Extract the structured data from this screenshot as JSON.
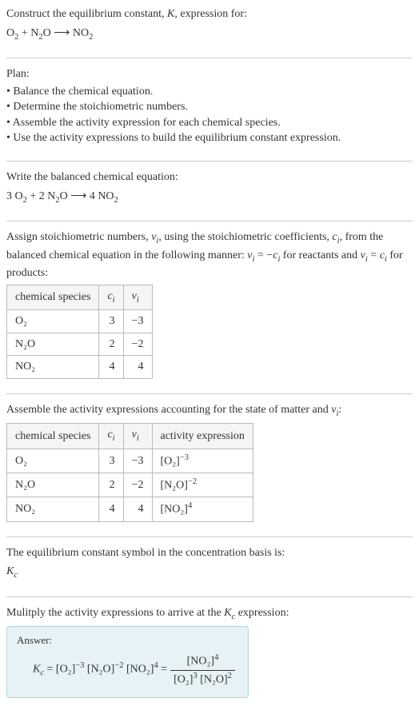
{
  "header": {
    "line1": "Construct the equilibrium constant, ",
    "kvar": "K",
    "line1b": ", expression for:",
    "equation_lhs": "O",
    "equation_plus": " + N",
    "equation_arrow": " ⟶ NO"
  },
  "plan": {
    "title": "Plan:",
    "items": [
      "• Balance the chemical equation.",
      "• Determine the stoichiometric numbers.",
      "• Assemble the activity expression for each chemical species.",
      "• Use the activity expressions to build the equilibrium constant expression."
    ]
  },
  "balanced": {
    "intro": "Write the balanced chemical equation:",
    "c1": "3 O",
    "c2": " + 2 N",
    "c3": "O ⟶ 4 NO"
  },
  "assign": {
    "intro1": "Assign stoichiometric numbers, ",
    "nu": "ν",
    "sub_i": "i",
    "intro2": ", using the stoichiometric coefficients, ",
    "cvar": "c",
    "intro3": ", from the balanced chemical equation in the following manner: ",
    "rel1": " = −",
    "rel2": " for reactants and ",
    "rel3": " = ",
    "rel4": " for products:",
    "headers": [
      "chemical species",
      "c",
      "ν"
    ],
    "rows": [
      {
        "species": "O₂",
        "c": "3",
        "nu": "−3"
      },
      {
        "species": "N₂O",
        "c": "2",
        "nu": "−2"
      },
      {
        "species": "NO₂",
        "c": "4",
        "nu": "4"
      }
    ]
  },
  "activity": {
    "intro": "Assemble the activity expressions accounting for the state of matter and ",
    "headers": [
      "chemical species",
      "c",
      "ν",
      "activity expression"
    ],
    "rows": [
      {
        "species": "O₂",
        "c": "3",
        "nu": "−3",
        "expr_base": "[O₂]",
        "expr_exp": "−3"
      },
      {
        "species": "N₂O",
        "c": "2",
        "nu": "−2",
        "expr_base": "[N₂O]",
        "expr_exp": "−2"
      },
      {
        "species": "NO₂",
        "c": "4",
        "nu": "4",
        "expr_base": "[NO₂]",
        "expr_exp": "4"
      }
    ]
  },
  "symbol": {
    "intro": "The equilibrium constant symbol in the concentration basis is:",
    "kc": "K",
    "sub": "c"
  },
  "multiply": {
    "intro1": "Mulitply the activity expressions to arrive at the ",
    "intro2": " expression:"
  },
  "answer": {
    "label": "Answer:",
    "kc": "K",
    "sub": "c",
    "eq": " = [O₂]",
    "e1": "−3",
    "t2": " [N₂O]",
    "e2": "−2",
    "t3": " [NO₂]",
    "e3": "4",
    "t4": " = ",
    "frac_num_base": "[NO₂]",
    "frac_num_exp": "4",
    "frac_den_a": "[O₂]",
    "frac_den_ae": "3",
    "frac_den_b": " [N₂O]",
    "frac_den_be": "2"
  }
}
